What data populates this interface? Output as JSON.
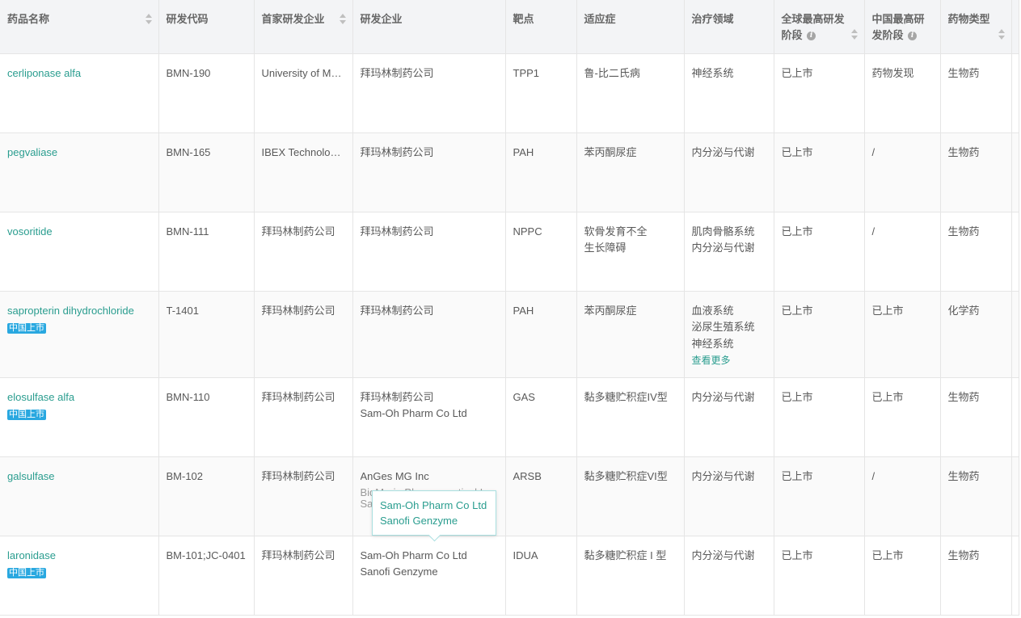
{
  "headers": {
    "drug_name": "药品名称",
    "code": "研发代码",
    "origin_company": "首家研发企业",
    "dev_company": "研发企业",
    "target": "靶点",
    "indication": "适应症",
    "therapeutic_area": "治疗领域",
    "global_phase": "全球最高研发阶段",
    "china_phase": "中国最高研发阶段",
    "drug_type": "药物类型"
  },
  "rows": [
    {
      "name": "cerliponase alfa",
      "badge": "",
      "code": "BMN-190",
      "origin": "University of Medicine a…",
      "dev": [
        "拜玛林制药公司"
      ],
      "target": "TPP1",
      "indication": [
        "鲁-比二氏病"
      ],
      "area": [
        "神经系统"
      ],
      "more": "",
      "global": "已上市",
      "china": "药物发现",
      "type": "生物药"
    },
    {
      "name": "pegvaliase",
      "badge": "",
      "code": "BMN-165",
      "origin": "IBEX Technologies Inc",
      "dev": [
        "拜玛林制药公司"
      ],
      "target": "PAH",
      "indication": [
        "苯丙酮尿症"
      ],
      "area": [
        "内分泌与代谢"
      ],
      "more": "",
      "global": "已上市",
      "china": "/",
      "type": "生物药"
    },
    {
      "name": "vosoritide",
      "badge": "",
      "code": "BMN-111",
      "origin": "拜玛林制药公司",
      "dev": [
        "拜玛林制药公司"
      ],
      "target": "NPPC",
      "indication": [
        "软骨发育不全",
        "生长障碍"
      ],
      "area": [
        "肌肉骨骼系统",
        "内分泌与代谢"
      ],
      "more": "",
      "global": "已上市",
      "china": "/",
      "type": "生物药"
    },
    {
      "name": "sapropterin dihydrochloride",
      "badge": "中国上市",
      "code": "T-1401",
      "origin": "拜玛林制药公司",
      "dev": [
        "拜玛林制药公司"
      ],
      "target": "PAH",
      "indication": [
        "苯丙酮尿症"
      ],
      "area": [
        "血液系统",
        "泌尿生殖系统",
        "神经系统"
      ],
      "more": "查看更多",
      "global": "已上市",
      "china": "已上市",
      "type": "化学药"
    },
    {
      "name": "elosulfase alfa",
      "badge": "中国上市",
      "code": "BMN-110",
      "origin": "拜玛林制药公司",
      "dev": [
        "拜玛林制药公司",
        "Sam-Oh Pharm Co Ltd"
      ],
      "target": "GAS",
      "indication": [
        "黏多糖贮积症IV型"
      ],
      "area": [
        "内分泌与代谢"
      ],
      "more": "",
      "global": "已上市",
      "china": "已上市",
      "type": "生物药"
    },
    {
      "name": "galsulfase",
      "badge": "",
      "code": "BM-102",
      "origin": "拜玛林制药公司",
      "dev": [
        "AnGes MG Inc",
        "BioMarin Pharmaceutical Inc",
        "Sam-Oh Pharm Co Ltd"
      ],
      "target": "ARSB",
      "indication": [
        "黏多糖贮积症VI型"
      ],
      "area": [
        "内分泌与代谢"
      ],
      "more": "",
      "global": "已上市",
      "china": "/",
      "type": "生物药"
    },
    {
      "name": "laronidase",
      "badge": "中国上市",
      "code": "BM-101;JC-0401",
      "origin": "拜玛林制药公司",
      "dev": [
        "Sam-Oh Pharm Co Ltd",
        "Sanofi Genzyme"
      ],
      "target": "IDUA",
      "indication": [
        "黏多糖贮积症 I 型"
      ],
      "area": [
        "内分泌与代谢"
      ],
      "more": "",
      "global": "已上市",
      "china": "已上市",
      "type": "生物药"
    }
  ],
  "tooltip": [
    "Sam-Oh Pharm Co Ltd",
    "Sanofi Genzyme"
  ]
}
